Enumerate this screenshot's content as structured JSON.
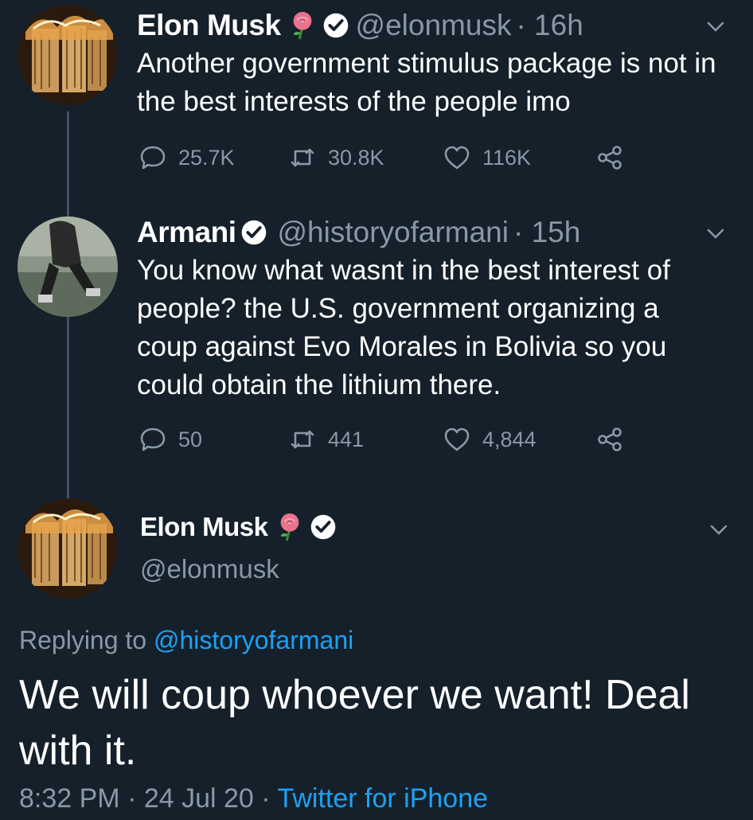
{
  "tweets": [
    {
      "name": "Elon Musk",
      "handle": "@elonmusk",
      "time": "· 16h",
      "text": "Another government stimulus package is not in the best interests of the people imo",
      "replies": "25.7K",
      "retweets": "30.8K",
      "likes": "116K"
    },
    {
      "name": "Armani",
      "handle": "@historyofarmani",
      "time": "· 15h",
      "text": "You know what wasnt in the best interest of people? the U.S. government organizing a coup against Evo Morales in Bolivia so you could obtain the lithium there.",
      "replies": "50",
      "retweets": "441",
      "likes": "4,844"
    }
  ],
  "main": {
    "name": "Elon Musk",
    "handle": "@elonmusk",
    "replying_prefix": "Replying to",
    "replying_to": "@historyofarmani",
    "text": "We will coup whoever we want! Deal with it.",
    "time": "8:32 PM · 24 Jul 20 ·",
    "source": "Twitter for iPhone"
  },
  "colors": {
    "background": "#15202b",
    "secondary_text": "#8899a6",
    "link": "#1da1f2"
  },
  "icons": [
    "rose-emoji-icon",
    "verified-badge-icon",
    "chevron-down-icon",
    "reply-icon",
    "retweet-icon",
    "like-icon",
    "share-icon"
  ]
}
